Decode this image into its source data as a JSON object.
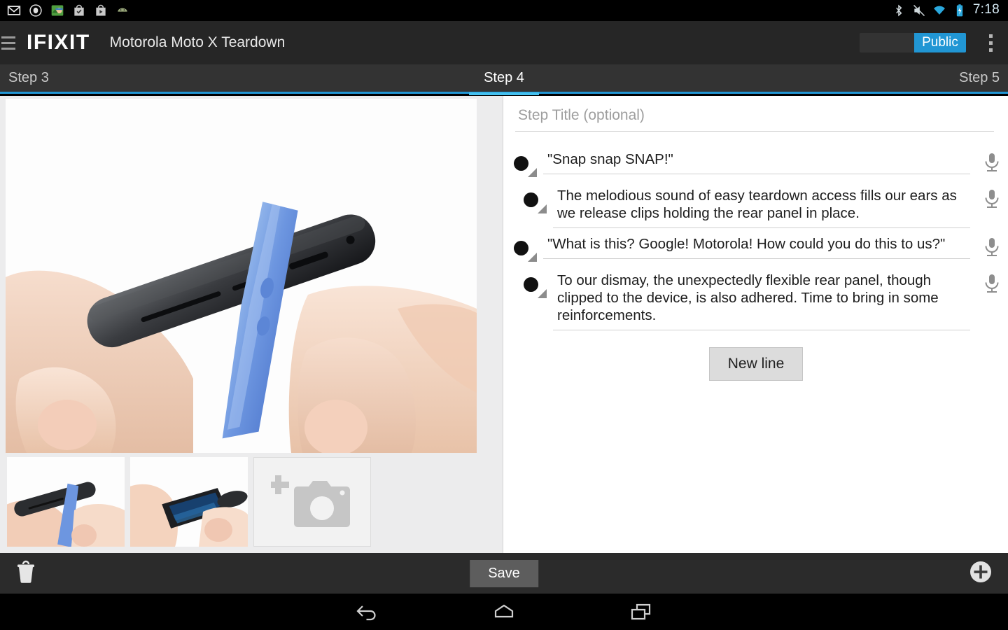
{
  "statusbar": {
    "notification_icons": [
      "gmail-icon",
      "disc-icon",
      "game-avatar-icon",
      "tasks-icon",
      "play-store-icon",
      "android-icon"
    ],
    "system_icons": [
      "bluetooth-icon",
      "volume-muted-icon",
      "wifi-icon",
      "battery-charging-icon"
    ],
    "clock": "7:18"
  },
  "actionbar": {
    "menu_icon": "hamburger-menu-icon",
    "brand": "IFIXIT",
    "document_title": "Motorola Moto X Teardown",
    "visibility_toggle": {
      "selected": "Public",
      "accent_color": "#2196d4"
    },
    "overflow_icon": "overflow-menu-icon"
  },
  "tabs": {
    "previous": "Step 3",
    "current": "Step 4",
    "next": "Step 5",
    "indicator_color": "#44c1f0"
  },
  "left_pane": {
    "hero_image_alt": "Hand holding black Moto X with blue plastic opening tool inserted into the rear panel seam",
    "thumbnails": [
      {
        "alt": "Blue opening tool prying the edge of the black phone"
      },
      {
        "alt": "Rear panel of the phone being flexed away from the device"
      }
    ],
    "add_photo": {
      "icon": "add-photo-camera-icon"
    }
  },
  "right_pane": {
    "step_title": {
      "value": "",
      "placeholder": "Step Title (optional)"
    },
    "bullets": [
      {
        "text": "\"Snap snap SNAP!\"",
        "indent": false,
        "marker": "black-bullet",
        "mic_icon": "microphone-icon"
      },
      {
        "text": "The melodious sound of easy teardown access fills our ears as we release clips holding the rear panel in place.",
        "indent": true,
        "marker": "black-bullet",
        "mic_icon": "microphone-icon"
      },
      {
        "text": "\"What is this? Google! Motorola! How could you do this to us?\"",
        "indent": false,
        "marker": "black-bullet",
        "mic_icon": "microphone-icon"
      },
      {
        "text": "To our dismay, the unexpectedly flexible rear panel, though clipped to the device, is also adhered. Time to bring in some reinforcements.",
        "indent": true,
        "marker": "black-bullet",
        "mic_icon": "microphone-icon"
      }
    ],
    "new_line_button": "New line"
  },
  "bottombar": {
    "delete_icon": "trash-icon",
    "save_label": "Save",
    "add_icon": "add-circle-icon"
  },
  "navbar": {
    "back_icon": "back-arrow-icon",
    "home_icon": "home-icon",
    "recents_icon": "recents-icon"
  }
}
